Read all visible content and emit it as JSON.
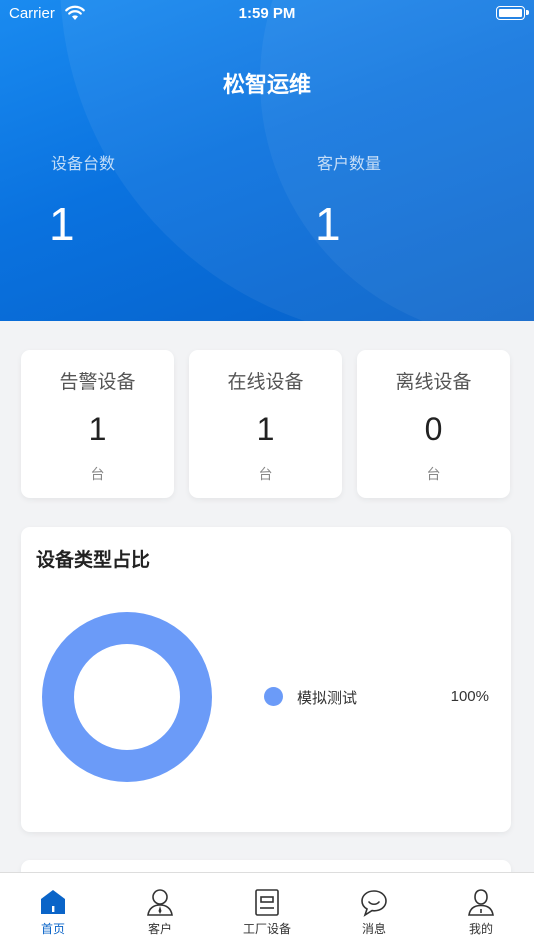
{
  "status_bar": {
    "carrier": "Carrier",
    "time": "1:59 PM"
  },
  "header": {
    "title": "松智运维",
    "stats": [
      {
        "label": "设备台数",
        "value": "1"
      },
      {
        "label": "客户数量",
        "value": "1"
      }
    ]
  },
  "summary_cards": [
    {
      "title": "告警设备",
      "value": "1",
      "unit": "台"
    },
    {
      "title": "在线设备",
      "value": "1",
      "unit": "台"
    },
    {
      "title": "离线设备",
      "value": "0",
      "unit": "台"
    }
  ],
  "device_type_card": {
    "title": "设备类型占比",
    "legend": [
      {
        "name": "模拟测试",
        "percent": "100%",
        "color": "#6b9bf8"
      }
    ]
  },
  "chart_data": {
    "type": "pie",
    "title": "设备类型占比",
    "categories": [
      "模拟测试"
    ],
    "values": [
      100
    ],
    "donut": true,
    "legend_position": "right"
  },
  "tab_bar": {
    "tabs": [
      {
        "label": "首页",
        "icon": "home-icon",
        "active": true
      },
      {
        "label": "客户",
        "icon": "customer-icon",
        "active": false
      },
      {
        "label": "工厂设备",
        "icon": "device-icon",
        "active": false
      },
      {
        "label": "消息",
        "icon": "message-icon",
        "active": false
      },
      {
        "label": "我的",
        "icon": "profile-icon",
        "active": false
      }
    ]
  },
  "colors": {
    "primary": "#0a72df",
    "accent": "#6b9bf8",
    "active_tab": "#0a64c8"
  }
}
